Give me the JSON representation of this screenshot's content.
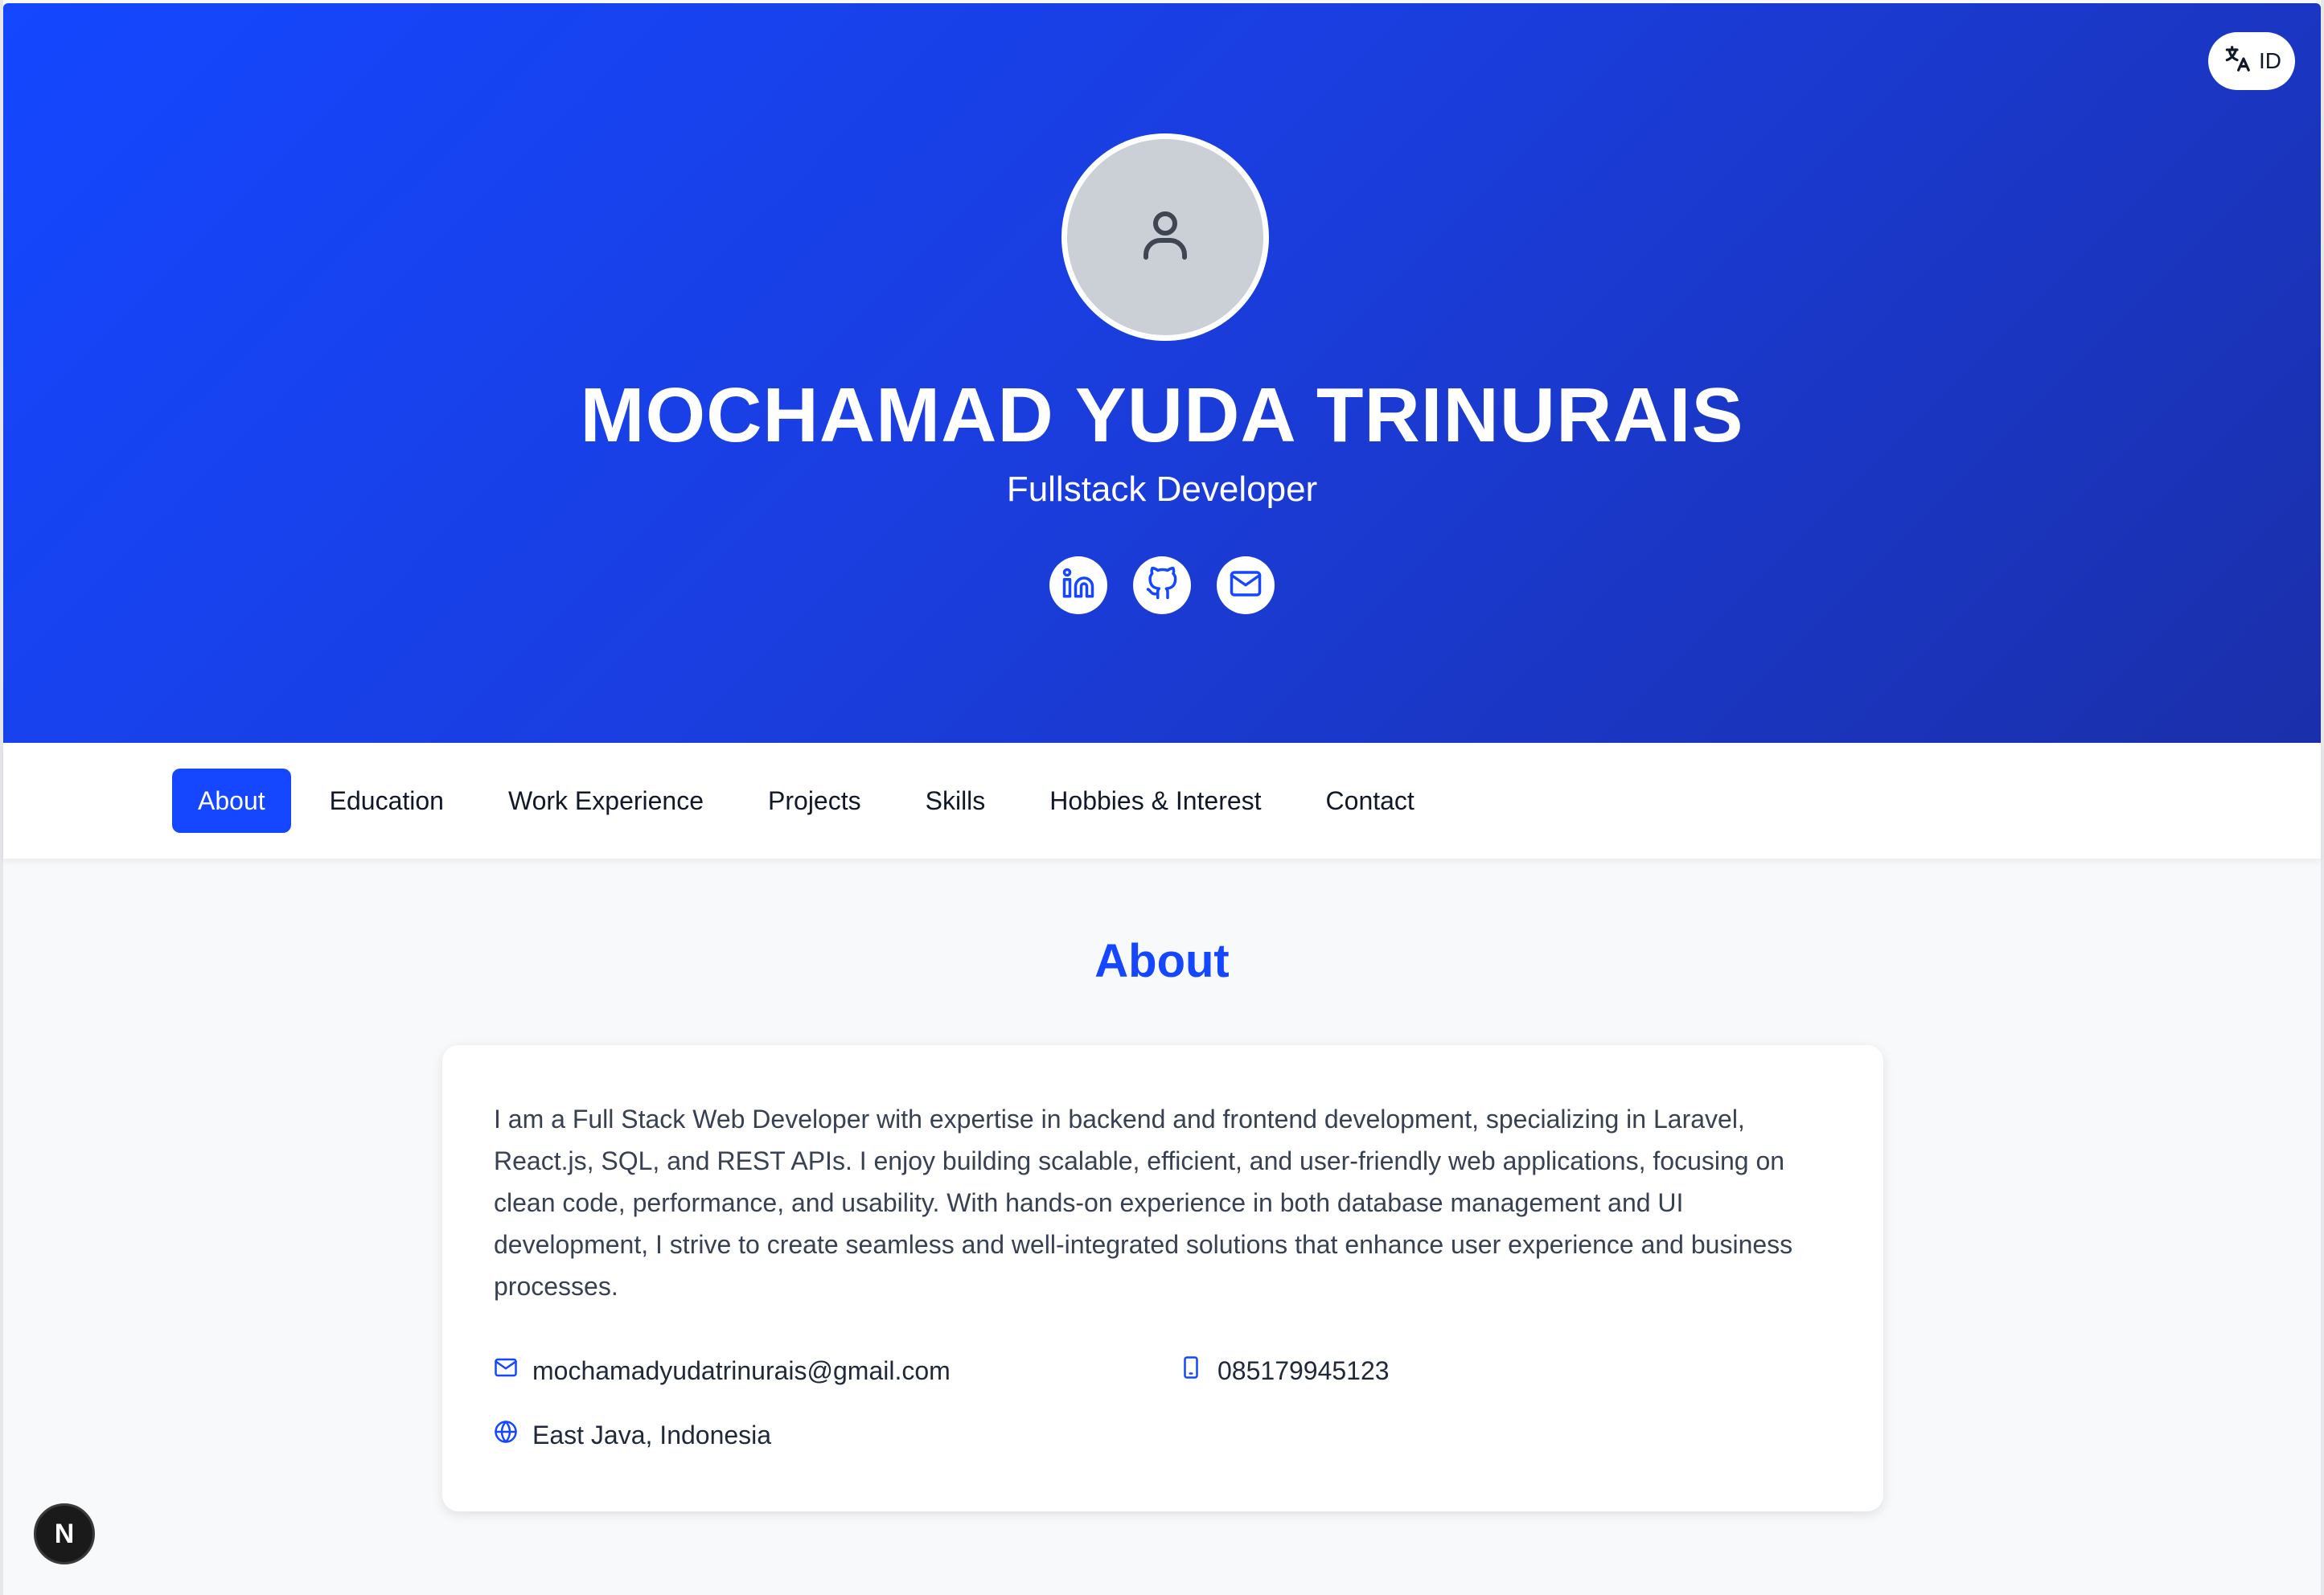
{
  "language_toggle": {
    "label": "ID",
    "icon": "translate-icon"
  },
  "profile": {
    "avatar_icon": "user-icon",
    "name": "MOCHAMAD YUDA TRINURAIS",
    "role": "Fullstack Developer",
    "socials": [
      {
        "icon": "linkedin-icon"
      },
      {
        "icon": "github-icon"
      },
      {
        "icon": "mail-icon"
      }
    ]
  },
  "nav": {
    "items": [
      {
        "label": "About",
        "active": true
      },
      {
        "label": "Education",
        "active": false
      },
      {
        "label": "Work Experience",
        "active": false
      },
      {
        "label": "Projects",
        "active": false
      },
      {
        "label": "Skills",
        "active": false
      },
      {
        "label": "Hobbies & Interest",
        "active": false
      },
      {
        "label": "Contact",
        "active": false
      }
    ]
  },
  "about": {
    "title": "About",
    "bio": "I am a Full Stack Web Developer with expertise in backend and frontend development, specializing in Laravel, React.js, SQL, and REST APIs. I enjoy building scalable, efficient, and user-friendly web applications, focusing on clean code, performance, and usability. With hands-on experience in both database management and UI development, I strive to create seamless and well-integrated solutions that enhance user experience and business processes.",
    "email": "mochamadyudatrinurais@gmail.com",
    "phone": "085179945123",
    "location": "East Java, Indonesia"
  },
  "dev_badge": {
    "label": "N"
  },
  "colors": {
    "accent": "#1447ff",
    "hero_end": "#1a2faa",
    "page_bg": "#f8f9fb"
  }
}
